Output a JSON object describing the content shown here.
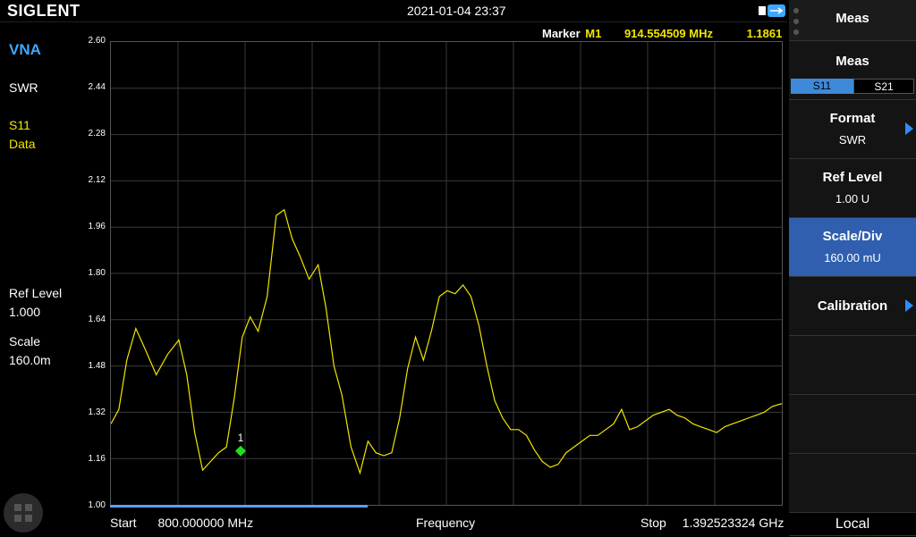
{
  "topbar": {
    "brand": "SIGLENT",
    "datetime": "2021-01-04 23:37",
    "usb_icon": "usb-icon"
  },
  "left_panel": {
    "mode": "VNA",
    "format": "SWR",
    "trace": "S11",
    "trace_type": "Data",
    "ref_level_label": "Ref Level",
    "ref_level_value": "1.000",
    "scale_label": "Scale",
    "scale_value": "160.0m"
  },
  "marker": {
    "label": "Marker",
    "id": "M1",
    "freq": "914.554509 MHz",
    "value": "1.1861",
    "flag": "1"
  },
  "bottom": {
    "start_label": "Start",
    "start_value": "800.000000 MHz",
    "center_label": "Frequency",
    "stop_label": "Stop",
    "stop_value": "1.392523324 GHz"
  },
  "right_menu": {
    "header": "Meas",
    "meas_title": "Meas",
    "tabs": [
      "S11",
      "S21"
    ],
    "format_title": "Format",
    "format_value": "SWR",
    "ref_title": "Ref Level",
    "ref_value": "1.00 U",
    "scale_title": "Scale/Div",
    "scale_value": "160.00 mU",
    "cal_title": "Calibration",
    "local": "Local"
  },
  "colors": {
    "trace": "#f2e600",
    "accent": "#3fa7ff",
    "marker": "#22dd22",
    "selected": "#3366bb"
  },
  "chart_data": {
    "type": "line",
    "xlabel": "Frequency",
    "x_range_mhz": [
      800.0,
      1392.523324
    ],
    "ylim": [
      1.0,
      2.6
    ],
    "y_ticks": [
      "2.60",
      "2.44",
      "2.28",
      "2.12",
      "1.96",
      "1.80",
      "1.64",
      "1.48",
      "1.32",
      "1.16",
      "1.00"
    ],
    "grid": true,
    "series": [
      {
        "x": [
          800,
          807,
          814,
          822,
          830,
          840,
          850,
          860,
          867,
          874,
          881,
          888,
          895,
          902,
          909,
          916,
          923,
          930,
          938,
          946,
          953,
          960,
          967,
          975,
          983,
          990,
          997,
          1004,
          1012,
          1020,
          1027,
          1034,
          1041,
          1048,
          1055,
          1062,
          1069,
          1076,
          1083,
          1090,
          1097,
          1104,
          1111,
          1118,
          1125,
          1132,
          1139,
          1146,
          1153,
          1160,
          1167,
          1174,
          1181,
          1188,
          1195,
          1202,
          1209,
          1216,
          1223,
          1230,
          1237,
          1244,
          1251,
          1258,
          1265,
          1272,
          1279,
          1286,
          1293,
          1300,
          1307,
          1314,
          1321,
          1328,
          1335,
          1342,
          1349,
          1356,
          1363,
          1370,
          1377,
          1384,
          1392.5
        ],
        "y": [
          1.28,
          1.33,
          1.5,
          1.61,
          1.54,
          1.45,
          1.52,
          1.57,
          1.45,
          1.25,
          1.12,
          1.15,
          1.18,
          1.2,
          1.37,
          1.58,
          1.65,
          1.6,
          1.72,
          2.0,
          2.02,
          1.92,
          1.86,
          1.78,
          1.83,
          1.68,
          1.48,
          1.38,
          1.2,
          1.11,
          1.22,
          1.18,
          1.17,
          1.18,
          1.3,
          1.47,
          1.58,
          1.5,
          1.6,
          1.72,
          1.74,
          1.73,
          1.76,
          1.72,
          1.62,
          1.48,
          1.36,
          1.3,
          1.26,
          1.26,
          1.24,
          1.19,
          1.15,
          1.13,
          1.14,
          1.18,
          1.2,
          1.22,
          1.24,
          1.24,
          1.26,
          1.28,
          1.33,
          1.26,
          1.27,
          1.29,
          1.31,
          1.32,
          1.33,
          1.31,
          1.3,
          1.28,
          1.27,
          1.26,
          1.25,
          1.27,
          1.28,
          1.29,
          1.3,
          1.31,
          1.32,
          1.34,
          1.35
        ]
      }
    ]
  }
}
